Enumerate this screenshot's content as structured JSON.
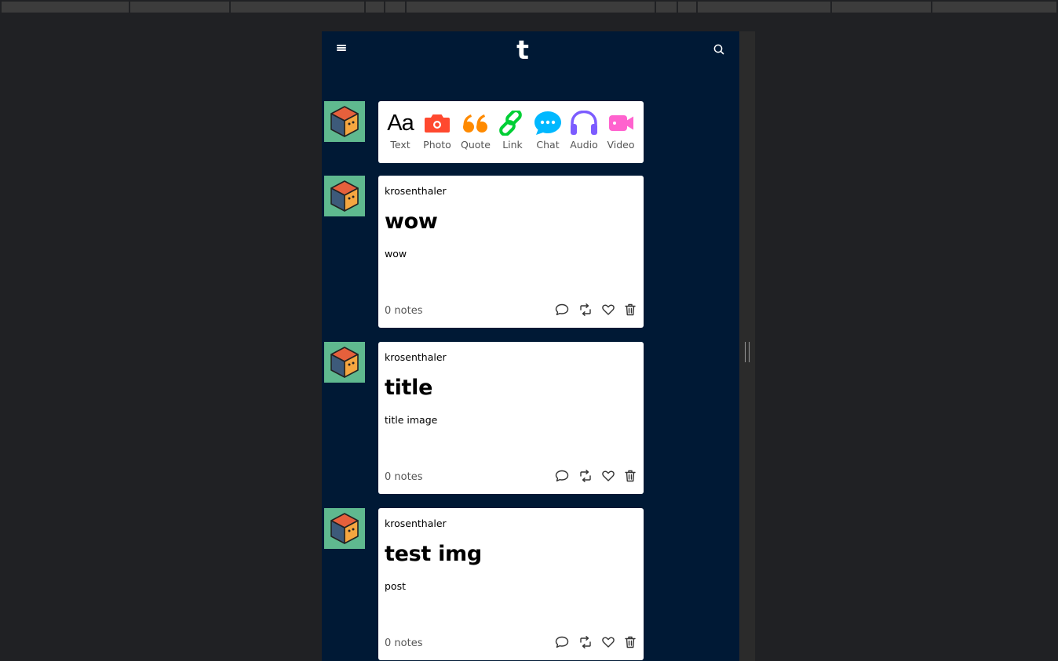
{
  "app": {
    "logo": "t"
  },
  "header": {
    "menu_icon": "hamburger-menu-icon",
    "search_icon": "search-icon"
  },
  "composer": {
    "types": [
      {
        "label": "Text",
        "glyph": "Aa",
        "icon": "text-icon",
        "color": "#000000"
      },
      {
        "label": "Photo",
        "icon": "camera-icon",
        "color": "#ff492f"
      },
      {
        "label": "Quote",
        "icon": "quote-icon",
        "color": "#ff8a00"
      },
      {
        "label": "Link",
        "icon": "link-icon",
        "color": "#00cf35"
      },
      {
        "label": "Chat",
        "icon": "chat-icon",
        "color": "#00b8ff"
      },
      {
        "label": "Audio",
        "icon": "headphones-icon",
        "color": "#7c5cff"
      },
      {
        "label": "Video",
        "icon": "video-camera-icon",
        "color": "#ff62ce"
      }
    ]
  },
  "posts": [
    {
      "author": "krosenthaler",
      "title": "wow",
      "body": "wow",
      "notes": "0 notes"
    },
    {
      "author": "krosenthaler",
      "title": "title",
      "body": "title image",
      "notes": "0 notes"
    },
    {
      "author": "krosenthaler",
      "title": "test img",
      "body": "post",
      "notes": "0 notes"
    }
  ],
  "post_actions": [
    "comment-icon",
    "reblog-icon",
    "heart-icon",
    "trash-icon"
  ],
  "colors": {
    "background": "#001935",
    "avatar_bg": "#5fb98f"
  }
}
